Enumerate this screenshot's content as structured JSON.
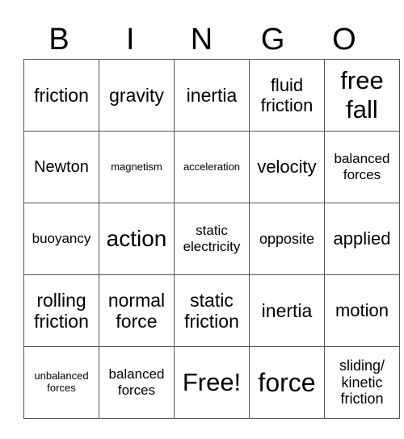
{
  "header": [
    "B",
    "I",
    "N",
    "G",
    "O"
  ],
  "rows": [
    [
      "friction",
      "gravity",
      "inertia",
      "fluid friction",
      "free fall"
    ],
    [
      "Newton",
      "magnetism",
      "acceleration",
      "velocity",
      "balanced forces"
    ],
    [
      "buoyancy",
      "action",
      "static electricity",
      "opposite",
      "applied"
    ],
    [
      "rolling friction",
      "normal force",
      "static friction",
      "inertia",
      "motion"
    ],
    [
      "unbalanced forces",
      "balanced forces",
      "Free!",
      "force",
      "sliding/ kinetic friction"
    ]
  ]
}
